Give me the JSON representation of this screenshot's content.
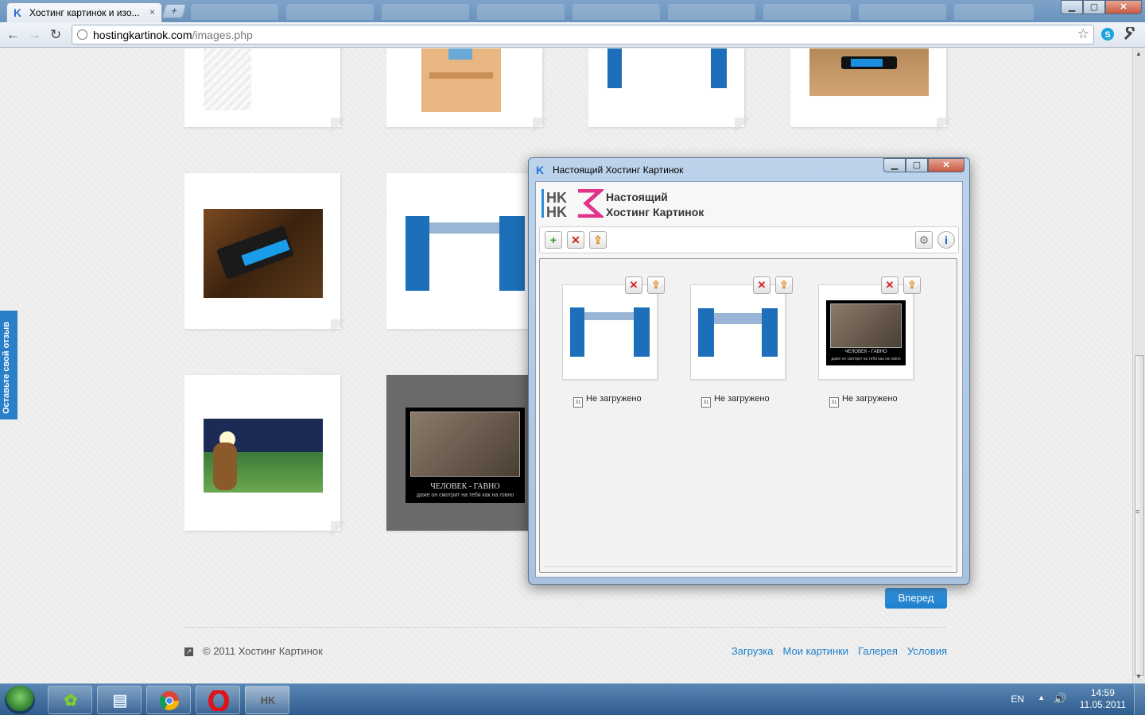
{
  "browser": {
    "tab_title": "Хостинг картинок и изо...",
    "tab_close": "×",
    "new_tab": "+",
    "url_host": "hostingkartinok.com",
    "url_path": "/images.php",
    "back_icon": "←",
    "forward_icon": "→",
    "reload_icon": "↻",
    "star_icon": "☆",
    "min_glyph": "▁",
    "max_glyph": "▢",
    "close_glyph": "✕"
  },
  "page": {
    "feedback_label": "Оставьте свой отзыв",
    "next_button": "Вперед",
    "footer_copy": "© 2011 Хостинг Картинок",
    "footer_links": [
      "Загрузка",
      "Мои картинки",
      "Галерея",
      "Условия"
    ]
  },
  "dialog": {
    "title": "Настоящий Хостинг Картинок",
    "brand_line1": "Настоящий",
    "brand_line2": "Хостинг Картинок",
    "toolbar": {
      "add_glyph": "+",
      "delete_glyph": "✕",
      "upload_glyph": "⇪",
      "settings_glyph": "⚙",
      "info_glyph": "i"
    },
    "items": [
      {
        "status": "Не загружено",
        "calendar_day": "31"
      },
      {
        "status": "Не загружено",
        "calendar_day": "31"
      },
      {
        "status": "Не загружено",
        "calendar_day": "31"
      }
    ],
    "item_delete_glyph": "✕",
    "item_upload_glyph": "⇪",
    "demotivator_title": "ЧЕЛОВЕК - ГАВНО",
    "demotivator_caption": "даже он смотрит на тебя как на говно"
  },
  "taskbar": {
    "lang": "EN",
    "time": "14:59",
    "date": "11.05.2011",
    "tray_arrow": "▲",
    "volume_icon": "🔊",
    "apps": [
      "icq-icon",
      "notepad-icon",
      "chrome-icon",
      "opera-icon",
      "hostingkartinok-app-icon"
    ]
  },
  "colors": {
    "accent": "#1d7fcb",
    "link": "#1d7fcb",
    "delete_red": "#d32020",
    "add_green": "#2a9a2a"
  }
}
